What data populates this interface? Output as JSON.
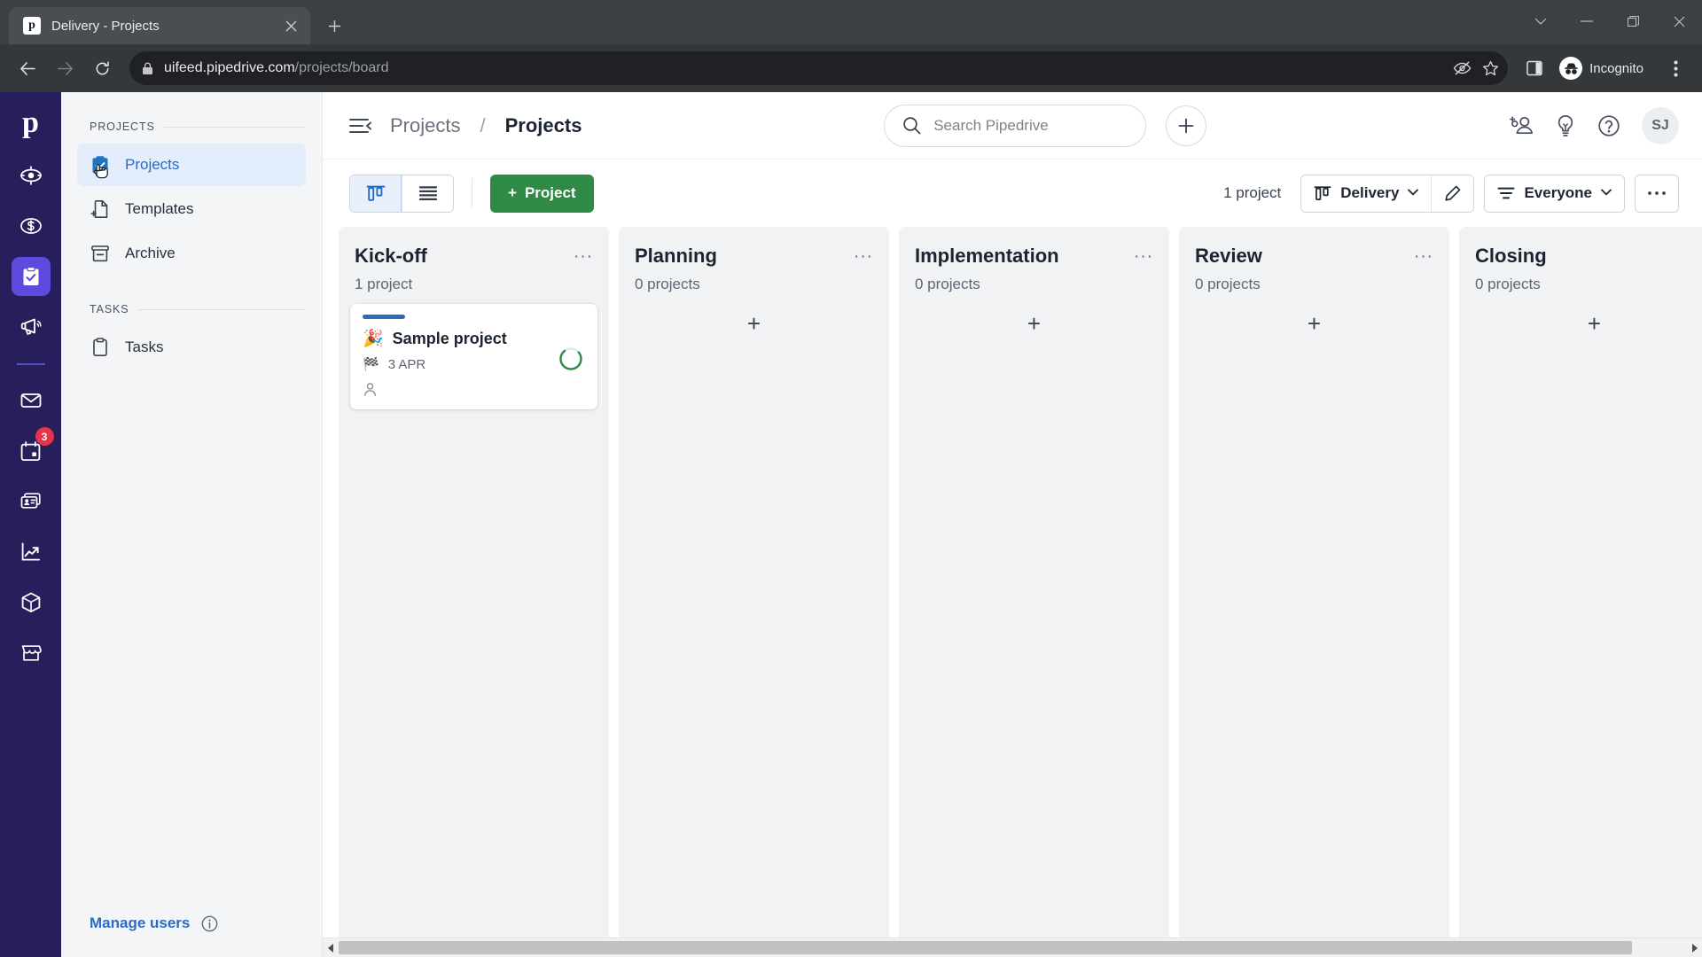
{
  "browser": {
    "tab": {
      "title": "Delivery - Projects",
      "favicon_letter": "p",
      "close_icon": "close-icon"
    },
    "new_tab_label": "+",
    "window_controls": {
      "dropdown": "⌄",
      "minimize": "—",
      "maximize": "◻",
      "close": "✕"
    },
    "toolbar": {
      "back": "back-arrow-icon",
      "forward": "forward-arrow-icon",
      "reload": "reload-icon",
      "url_domain": "uifeed.pipedrive.com",
      "url_path": "/projects/board",
      "full_url": "uifeed.pipedrive.com/projects/board",
      "profile_label": "Incognito"
    }
  },
  "rail": {
    "logo": "p",
    "items": [
      {
        "name": "leads-icon",
        "label": "Leads"
      },
      {
        "name": "deals-icon",
        "label": "Deals"
      },
      {
        "name": "projects-icon",
        "label": "Projects",
        "active": true
      },
      {
        "name": "campaigns-icon",
        "label": "Campaigns"
      },
      {
        "name": "mail-icon",
        "label": "Mail"
      },
      {
        "name": "calendar-icon",
        "label": "Activities",
        "badge": "3"
      },
      {
        "name": "contacts-icon",
        "label": "Contacts"
      },
      {
        "name": "insights-icon",
        "label": "Insights"
      },
      {
        "name": "products-icon",
        "label": "Products"
      },
      {
        "name": "marketplace-icon",
        "label": "Marketplace"
      }
    ]
  },
  "sidebar": {
    "sections": [
      {
        "label": "PROJECTS",
        "items": [
          {
            "label": "Projects",
            "icon": "clipboard-check-icon",
            "active": true
          },
          {
            "label": "Templates",
            "icon": "file-plus-icon",
            "active": false
          },
          {
            "label": "Archive",
            "icon": "archive-box-icon",
            "active": false
          }
        ]
      },
      {
        "label": "TASKS",
        "items": [
          {
            "label": "Tasks",
            "icon": "clipboard-icon",
            "active": false
          }
        ]
      }
    ],
    "footer": {
      "manage_users": "Manage users",
      "info_icon": "info-circle-icon"
    }
  },
  "topbar": {
    "menu_icon": "collapse-menu-icon",
    "breadcrumb": {
      "parent": "Projects",
      "separator": "/",
      "current": "Projects"
    },
    "search": {
      "placeholder": "Search Pipedrive",
      "icon": "search-icon"
    },
    "add_button": "+",
    "actions": [
      {
        "name": "invite-users-icon",
        "label": "Invite users"
      },
      {
        "name": "lightbulb-icon",
        "label": "What's new"
      },
      {
        "name": "help-icon",
        "label": "Help"
      }
    ],
    "avatar_initials": "SJ"
  },
  "board_toolbar": {
    "view_board_icon": "board-view-icon",
    "view_list_icon": "list-view-icon",
    "new_project_label": "Project",
    "new_project_plus": "+",
    "new_project_color": "#2f8a45",
    "count_label": "1 project",
    "pipeline_selector": {
      "label": "Delivery",
      "icon": "board-view-icon",
      "caret": "▼"
    },
    "edit_icon": "pencil-icon",
    "filter_selector": {
      "label": "Everyone",
      "icon": "filter-icon",
      "caret": "▼"
    },
    "more_icon": "ellipsis-icon"
  },
  "board": {
    "columns": [
      {
        "title": "Kick-off",
        "count": "1 project",
        "dots": "···",
        "add": "+",
        "cards": [
          {
            "bar_color": "#2f6bbd",
            "emoji": "🎉",
            "title": "Sample project",
            "meta_icon": "checkered-flag-icon",
            "meta_text": "3 APR",
            "person_icon": "person-icon",
            "progress_pct": 75,
            "progress_color": "#2f8a45"
          }
        ]
      },
      {
        "title": "Planning",
        "count": "0 projects",
        "dots": "···",
        "add": "+",
        "cards": []
      },
      {
        "title": "Implementation",
        "count": "0 projects",
        "dots": "···",
        "add": "+",
        "cards": []
      },
      {
        "title": "Review",
        "count": "0 projects",
        "dots": "···",
        "add": "+",
        "cards": []
      },
      {
        "title": "Closing",
        "count": "0 projects",
        "dots": "",
        "add": "+",
        "cards": []
      }
    ],
    "scrollbar": {
      "left_arrow": "◀",
      "right_arrow": "▶"
    }
  }
}
